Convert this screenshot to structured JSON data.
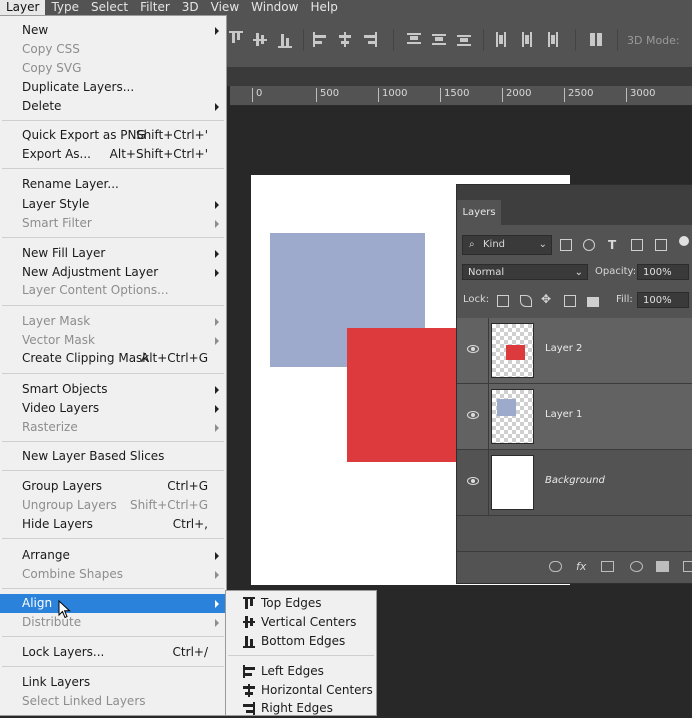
{
  "menubar": {
    "items": [
      "Layer",
      "Type",
      "Select",
      "Filter",
      "3D",
      "View",
      "Window",
      "Help"
    ]
  },
  "options_bar": {
    "mode_label": "3D Mode:"
  },
  "ruler": {
    "ticks": [
      "0",
      "500",
      "1000",
      "1500",
      "2000",
      "2500",
      "3000"
    ]
  },
  "layer_menu": {
    "items": [
      {
        "label": "New",
        "shortcut": "",
        "submenu": true,
        "disabled": false
      },
      {
        "label": "Copy CSS",
        "shortcut": "",
        "submenu": false,
        "disabled": true
      },
      {
        "label": "Copy SVG",
        "shortcut": "",
        "submenu": false,
        "disabled": true
      },
      {
        "label": "Duplicate Layers...",
        "shortcut": "",
        "submenu": false,
        "disabled": false
      },
      {
        "label": "Delete",
        "shortcut": "",
        "submenu": true,
        "disabled": false
      },
      {
        "label": "Quick Export as PNG",
        "shortcut": "Shift+Ctrl+'",
        "submenu": false,
        "disabled": false
      },
      {
        "label": "Export As...",
        "shortcut": "Alt+Shift+Ctrl+'",
        "submenu": false,
        "disabled": false
      },
      {
        "label": "Rename Layer...",
        "shortcut": "",
        "submenu": false,
        "disabled": false
      },
      {
        "label": "Layer Style",
        "shortcut": "",
        "submenu": true,
        "disabled": false
      },
      {
        "label": "Smart Filter",
        "shortcut": "",
        "submenu": true,
        "disabled": true
      },
      {
        "label": "New Fill Layer",
        "shortcut": "",
        "submenu": true,
        "disabled": false
      },
      {
        "label": "New Adjustment Layer",
        "shortcut": "",
        "submenu": true,
        "disabled": false
      },
      {
        "label": "Layer Content Options...",
        "shortcut": "",
        "submenu": false,
        "disabled": true
      },
      {
        "label": "Layer Mask",
        "shortcut": "",
        "submenu": true,
        "disabled": true
      },
      {
        "label": "Vector Mask",
        "shortcut": "",
        "submenu": true,
        "disabled": true
      },
      {
        "label": "Create Clipping Mask",
        "shortcut": "Alt+Ctrl+G",
        "submenu": false,
        "disabled": false
      },
      {
        "label": "Smart Objects",
        "shortcut": "",
        "submenu": true,
        "disabled": false
      },
      {
        "label": "Video Layers",
        "shortcut": "",
        "submenu": true,
        "disabled": false
      },
      {
        "label": "Rasterize",
        "shortcut": "",
        "submenu": true,
        "disabled": true
      },
      {
        "label": "New Layer Based Slices",
        "shortcut": "",
        "submenu": false,
        "disabled": false
      },
      {
        "label": "Group Layers",
        "shortcut": "Ctrl+G",
        "submenu": false,
        "disabled": false
      },
      {
        "label": "Ungroup Layers",
        "shortcut": "Shift+Ctrl+G",
        "submenu": false,
        "disabled": true
      },
      {
        "label": "Hide Layers",
        "shortcut": "Ctrl+,",
        "submenu": false,
        "disabled": false
      },
      {
        "label": "Arrange",
        "shortcut": "",
        "submenu": true,
        "disabled": false
      },
      {
        "label": "Combine Shapes",
        "shortcut": "",
        "submenu": true,
        "disabled": true
      },
      {
        "label": "Align",
        "shortcut": "",
        "submenu": true,
        "disabled": false,
        "highlighted": true
      },
      {
        "label": "Distribute",
        "shortcut": "",
        "submenu": true,
        "disabled": true
      },
      {
        "label": "Lock Layers...",
        "shortcut": "Ctrl+/",
        "submenu": false,
        "disabled": false
      },
      {
        "label": "Link Layers",
        "shortcut": "",
        "submenu": false,
        "disabled": false
      },
      {
        "label": "Select Linked Layers",
        "shortcut": "",
        "submenu": false,
        "disabled": true
      }
    ]
  },
  "align_submenu": {
    "items": [
      {
        "label": "Top Edges",
        "icon": "align-top-edges-icon"
      },
      {
        "label": "Vertical Centers",
        "icon": "align-vertical-centers-icon"
      },
      {
        "label": "Bottom Edges",
        "icon": "align-bottom-edges-icon"
      },
      {
        "label": "Left Edges",
        "icon": "align-left-edges-icon"
      },
      {
        "label": "Horizontal Centers",
        "icon": "align-horizontal-centers-icon"
      },
      {
        "label": "Right Edges",
        "icon": "align-right-edges-icon"
      }
    ]
  },
  "layers_panel": {
    "tab": "Layers",
    "filter_kind": "Kind",
    "blend_mode": "Normal",
    "opacity_label": "Opacity:",
    "opacity_value": "100%",
    "lock_label": "Lock:",
    "fill_label": "Fill:",
    "fill_value": "100%",
    "layers": [
      {
        "name": "Layer 2",
        "swatch": "#dc3a3d",
        "selected": true
      },
      {
        "name": "Layer 1",
        "swatch": "#9daacb",
        "selected": true
      },
      {
        "name": "Background",
        "swatch": "#ffffff",
        "selected": false
      }
    ]
  },
  "colors": {
    "menu_highlight": "#2a82da",
    "blue_shape": "#9daacb",
    "red_shape": "#dc3a3d"
  }
}
